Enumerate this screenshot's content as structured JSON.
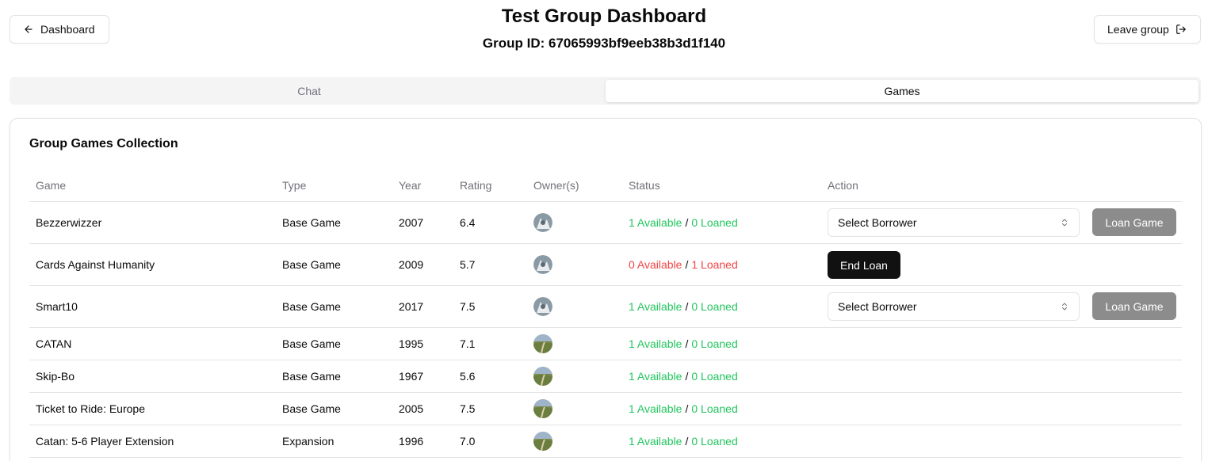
{
  "header": {
    "back_label": "Dashboard",
    "title": "Test Group Dashboard",
    "group_id_text": "Group ID: 67065993bf9eeb38b3d1f140",
    "leave_label": "Leave group"
  },
  "tabs": [
    {
      "label": "Chat",
      "active": false
    },
    {
      "label": "Games",
      "active": true
    }
  ],
  "collection": {
    "title": "Group Games Collection",
    "columns": [
      "Game",
      "Type",
      "Year",
      "Rating",
      "Owner(s)",
      "Status",
      "Action"
    ],
    "rows": [
      {
        "game": "Bezzerwizzer",
        "type": "Base Game",
        "year": "2007",
        "rating": "6.4",
        "owner_avatar": "owner-a",
        "available": "1 Available",
        "loaned": "0 Loaned",
        "status_color": "#22c55e",
        "action": "select",
        "select_label": "Select Borrower",
        "button_label": "Loan Game"
      },
      {
        "game": "Cards Against Humanity",
        "type": "Base Game",
        "year": "2009",
        "rating": "5.7",
        "owner_avatar": "owner-a",
        "available": "0 Available",
        "loaned": "1 Loaned",
        "status_color": "#ef4444",
        "action": "end",
        "button_label": "End Loan"
      },
      {
        "game": "Smart10",
        "type": "Base Game",
        "year": "2017",
        "rating": "7.5",
        "owner_avatar": "owner-a",
        "available": "1 Available",
        "loaned": "0 Loaned",
        "status_color": "#22c55e",
        "action": "select",
        "select_label": "Select Borrower",
        "button_label": "Loan Game"
      },
      {
        "game": "CATAN",
        "type": "Base Game",
        "year": "1995",
        "rating": "7.1",
        "owner_avatar": "owner-b",
        "available": "1 Available",
        "loaned": "0 Loaned",
        "status_color": "#22c55e",
        "action": "none"
      },
      {
        "game": "Skip-Bo",
        "type": "Base Game",
        "year": "1967",
        "rating": "5.6",
        "owner_avatar": "owner-b",
        "available": "1 Available",
        "loaned": "0 Loaned",
        "status_color": "#22c55e",
        "action": "none"
      },
      {
        "game": "Ticket to Ride: Europe",
        "type": "Base Game",
        "year": "2005",
        "rating": "7.5",
        "owner_avatar": "owner-b",
        "available": "1 Available",
        "loaned": "0 Loaned",
        "status_color": "#22c55e",
        "action": "none"
      },
      {
        "game": "Catan: 5-6 Player Extension",
        "type": "Expansion",
        "year": "1996",
        "rating": "7.0",
        "owner_avatar": "owner-b",
        "available": "1 Available",
        "loaned": "0 Loaned",
        "status_color": "#22c55e",
        "action": "none"
      }
    ]
  },
  "icons": {
    "back": "arrow-left-icon",
    "leave": "log-out-icon",
    "select": "chevrons-up-down-icon"
  },
  "colors": {
    "available": "#22c55e",
    "unavailable": "#ef4444",
    "loan_button_disabled": "#8c8c8c",
    "end_loan_button": "#111111"
  }
}
